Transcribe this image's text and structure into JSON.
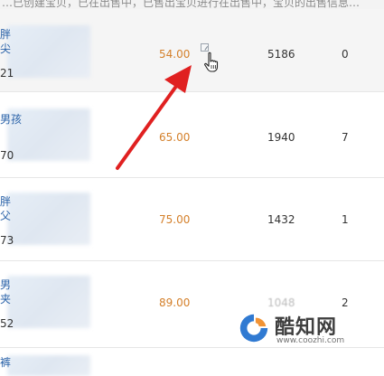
{
  "top_bar": {
    "text": "…已创建宝贝，已在出售中，已售出宝贝进行在出售中，宝贝的出售信息…"
  },
  "rows": [
    {
      "title_line1": "胖",
      "title_line2": "尖",
      "code": "21",
      "price": "54.00",
      "stock": "5186",
      "sales": "0"
    },
    {
      "title_line1": "男孩",
      "title_line2": "",
      "code": "70",
      "price": "65.00",
      "stock": "1940",
      "sales": "7"
    },
    {
      "title_line1": "胖",
      "title_line2": "父",
      "code": "73",
      "price": "75.00",
      "stock": "1432",
      "sales": "1"
    },
    {
      "title_line1": "男",
      "title_line2": "夹",
      "code": "52",
      "price": "89.00",
      "stock": "1048",
      "sales": "2"
    },
    {
      "title_line1": "裤",
      "title_line2": "",
      "code": "",
      "price": "",
      "stock": "",
      "sales": ""
    }
  ],
  "icons": {
    "edit_icon": "edit-icon",
    "cursor": "hand-pointer-icon"
  },
  "annotation": {
    "arrow_color": "#e02020"
  },
  "watermark": {
    "title": "酷知网",
    "url": "www.coozhi.com",
    "logo_colors": [
      "#1f6fcf",
      "#f08a24"
    ]
  }
}
